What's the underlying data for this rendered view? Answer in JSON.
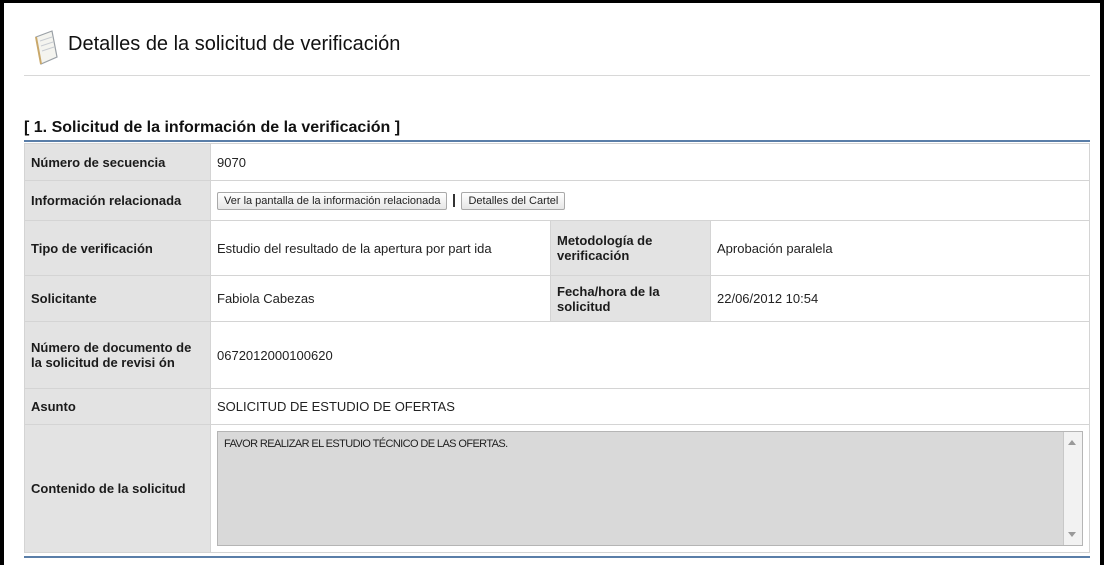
{
  "page": {
    "title": "Detalles de la solicitud de verificación",
    "section_title": "[ 1. Solicitud de la información de la verificación ]"
  },
  "fields": {
    "secuencia_label": "Número de secuencia",
    "secuencia_value": "9070",
    "info_rel_label": "Información relacionada",
    "btn_ver_pantalla": "Ver la pantalla de la información relacionada",
    "btn_detalles_cartel": "Detalles del Cartel",
    "tipo_label": "Tipo de verificación",
    "tipo_value": "Estudio del resultado de la apertura por part ida",
    "metodologia_label": "Metodología de verificación",
    "metodologia_value": "Aprobación paralela",
    "solicitante_label": "Solicitante",
    "solicitante_value": "Fabiola Cabezas",
    "fecha_label": "Fecha/hora de la solicitud",
    "fecha_value": "22/06/2012 10:54",
    "numdoc_label": "Número de documento de la solicitud de revisi ón",
    "numdoc_value": "0672012000100620",
    "asunto_label": "Asunto",
    "asunto_value": "SOLICITUD DE ESTUDIO DE OFERTAS",
    "contenido_label": "Contenido de la solicitud",
    "contenido_value": "FAVOR REALIZAR EL ESTUDIO TÉCNICO DE LAS OFERTAS."
  },
  "icons": {
    "header_icon": "notepad-icon"
  },
  "colors": {
    "label_bg": "#e3e3e3",
    "link": "#2c3ea3",
    "section_line": "#5a7ea8"
  }
}
